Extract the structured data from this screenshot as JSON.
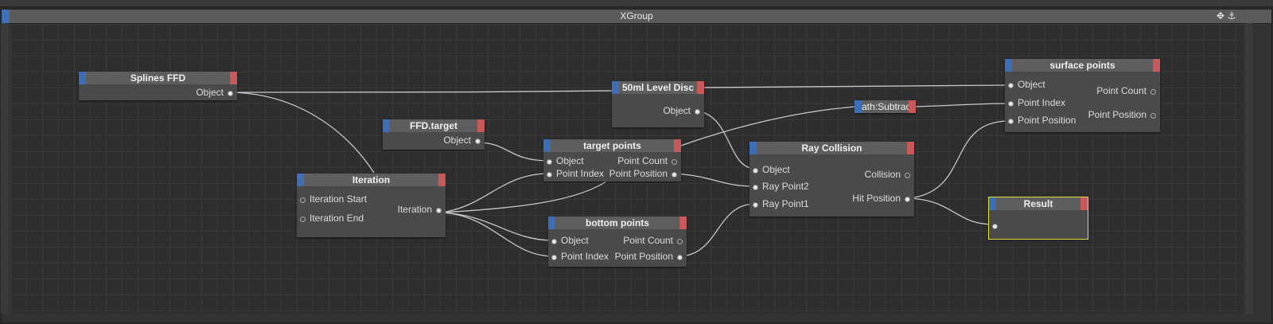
{
  "window": {
    "title": "XGroup",
    "icons": [
      "move-icon",
      "anchor-icon"
    ]
  },
  "nodes": {
    "splines_ffd": {
      "title": "Splines FFD",
      "outputs": [
        "Object"
      ]
    },
    "ffd_target": {
      "title": "FFD.target",
      "outputs": [
        "Object"
      ]
    },
    "iteration": {
      "title": "Iteration",
      "inputs": [
        "Iteration Start",
        "Iteration End"
      ],
      "outputs": [
        "Iteration"
      ]
    },
    "level_disc": {
      "title": "50ml Level Disc",
      "outputs": [
        "Object"
      ]
    },
    "math_subtract": {
      "title": "lath:Subtrac"
    },
    "target_points": {
      "title": "target points",
      "inputs": [
        "Object",
        "Point Index"
      ],
      "outputs": [
        "Point Count",
        "Point Position"
      ]
    },
    "bottom_points": {
      "title": "bottom points",
      "inputs": [
        "Object",
        "Point Index"
      ],
      "outputs": [
        "Point Count",
        "Point Position"
      ]
    },
    "ray_collision": {
      "title": "Ray Collision",
      "inputs": [
        "Object",
        "Ray Point2",
        "Ray Point1"
      ],
      "outputs": [
        "Collision",
        "Hit Position"
      ]
    },
    "surface_points": {
      "title": "surface points",
      "inputs": [
        "Object",
        "Point Index",
        "Point Position"
      ],
      "outputs": [
        "Point Count",
        "Point Position"
      ]
    },
    "result": {
      "title": "Result"
    }
  },
  "colors": {
    "input_cap": "#3e6fb5",
    "output_cap": "#c65a5a",
    "selection": "#e3dc3c",
    "wire": "#c8c8c8"
  }
}
